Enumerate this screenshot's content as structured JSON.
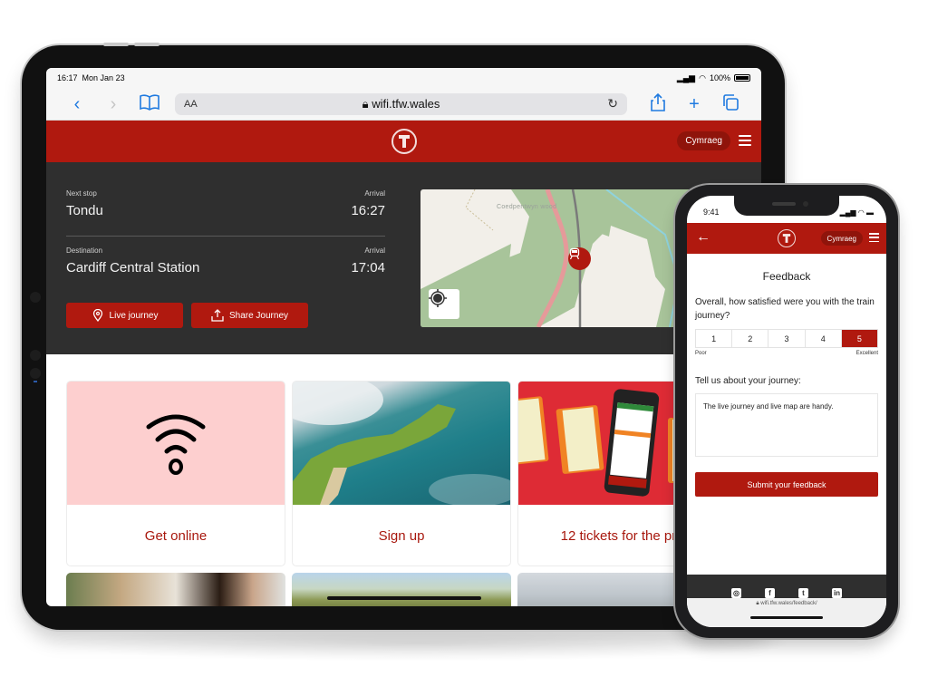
{
  "tablet": {
    "status_bar": {
      "time": "16:17",
      "date": "Mon Jan 23",
      "battery": "100%"
    },
    "browser": {
      "text_size_label": "AA",
      "url": "wifi.tfw.wales",
      "icons": [
        "back-icon",
        "forward-icon",
        "bookmarks-icon",
        "lock-icon",
        "reload-icon",
        "share-icon",
        "new-tab-icon",
        "tabs-icon"
      ]
    },
    "header": {
      "language_button": "Cymraeg",
      "menu_icon": "hamburger-icon",
      "logo": "tfw-logo"
    },
    "journey": {
      "next_stop_label": "Next stop",
      "next_stop": "Tondu",
      "next_arrival_label": "Arrival",
      "next_arrival": "16:27",
      "destination_label": "Destination",
      "destination": "Cardiff Central Station",
      "destination_arrival_label": "Arrival",
      "destination_arrival": "17:04",
      "live_journey_button": "Live journey",
      "share_journey_button": "Share Journey"
    },
    "map": {
      "place_label": "Coedpentwyn wood"
    },
    "cards": [
      {
        "title": "Get online",
        "image": "wifi-icon"
      },
      {
        "title": "Sign up",
        "image": "coastline-aerial-photo"
      },
      {
        "title": "12 tickets for the price",
        "image": "train-tickets-photo"
      }
    ]
  },
  "phone": {
    "status_bar": {
      "time": "9:41"
    },
    "header": {
      "language_button": "Cymraeg"
    },
    "feedback": {
      "title": "Feedback",
      "question": "Overall, how satisfied were you with the train journey?",
      "rating_options": [
        "1",
        "2",
        "3",
        "4",
        "5"
      ],
      "selected_rating": "5",
      "low_label": "Poor",
      "high_label": "Excellent",
      "comment_label": "Tell us about your journey:",
      "comment_value": "The live journey and live map are handy.",
      "submit_button": "Submit your feedback"
    },
    "footer": {
      "social": [
        "instagram",
        "facebook",
        "twitter",
        "linkedin"
      ]
    },
    "url": "wifi.tfw.wales/feedback/"
  },
  "colors": {
    "brand_red": "#b0190f",
    "dark_panel": "#2f2f2f",
    "pill_red": "#8f140b",
    "card_pink": "#fdcfcf"
  }
}
